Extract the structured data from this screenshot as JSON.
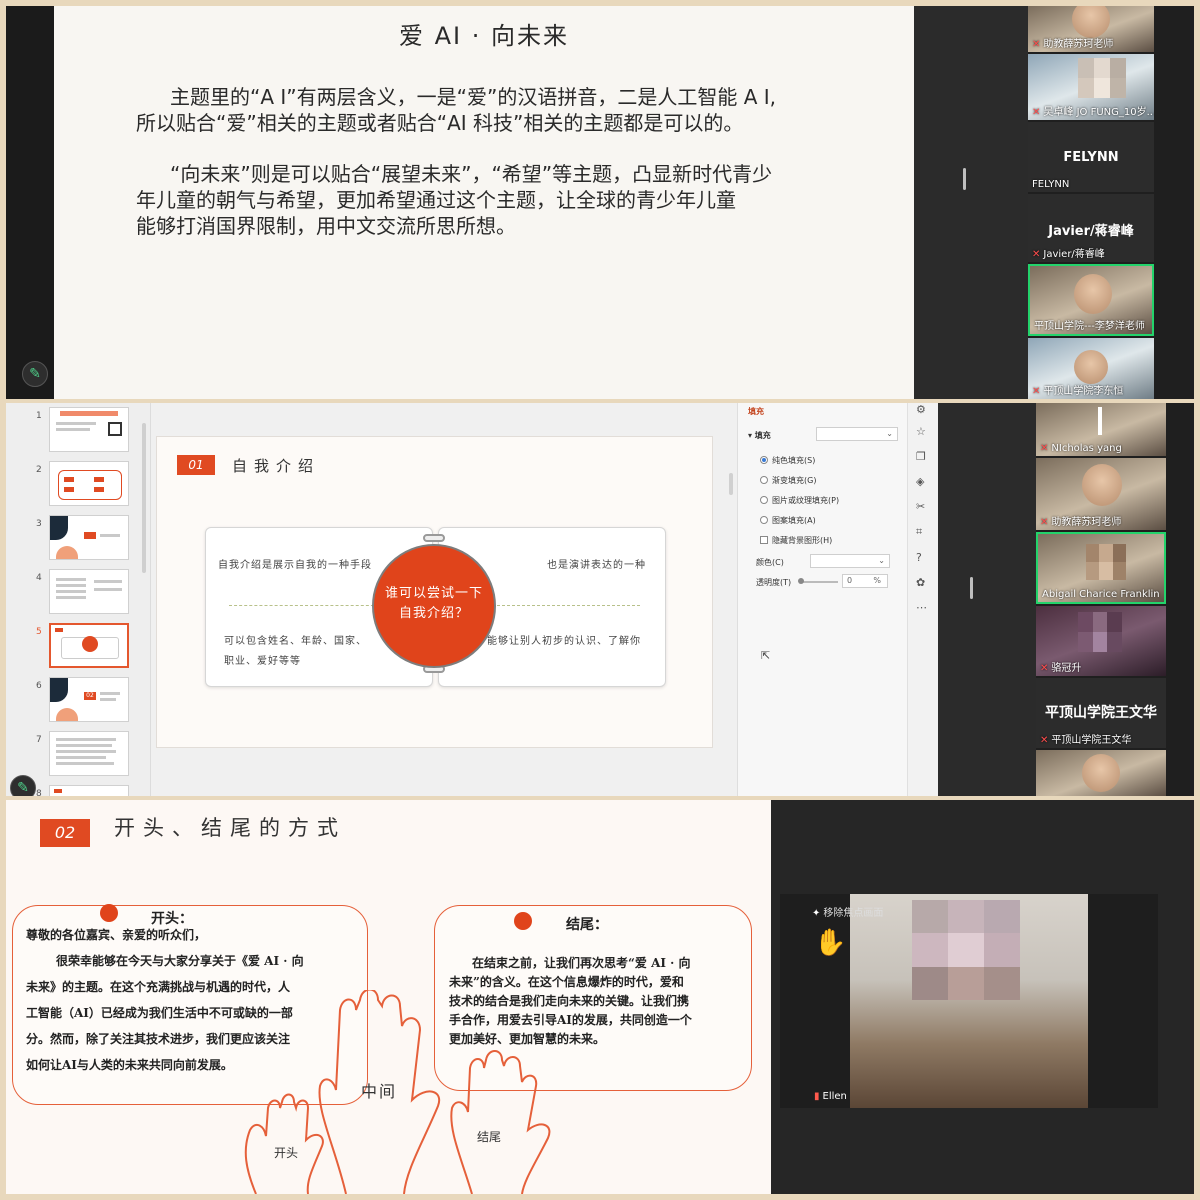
{
  "panel1": {
    "slide": {
      "title": "爱 AI · 向未来",
      "para1_l1": "主题里的“A I”有两层含义，一是“爱”的汉语拼音，二是人工智能 A I,",
      "para1_l2": "所以贴合“爱”相关的主题或者贴合“AI 科技”相关的主题都是可以的。",
      "para2_l1": "“向未来”则是可以贴合“展望未来”，“希望”等主题，凸显新时代青少",
      "para2_l2": "年儿童的朝气与希望，更加希望通过这个主题，让全球的青少年儿童",
      "para2_l3": "能够打消国界限制，用中文交流所思所想。"
    },
    "participants": [
      {
        "name": "助教薛苏珂老师"
      },
      {
        "name": "吴卓峰 JO FUNG_10岁..."
      },
      {
        "big": "FELYNN",
        "name": "FELYNN"
      },
      {
        "big": "Javier/蒋睿峰",
        "name": "Javier/蒋睿峰"
      },
      {
        "name": "平顶山学院---李梦洋老师"
      },
      {
        "name": "平顶山学院李东恒"
      }
    ]
  },
  "panel2": {
    "thumb_numbers": [
      "1",
      "2",
      "3",
      "4",
      "5",
      "6",
      "7",
      "8"
    ],
    "slide": {
      "badge": "01",
      "title": "自我介绍",
      "circle_l1": "谁可以尝试一下",
      "circle_l2": "自我介绍？",
      "left_top": "自我介绍是展示自我的一种手段",
      "left_bottom_l1": "可以包含姓名、年龄、国家、",
      "left_bottom_l2": "职业、爱好等等",
      "right_top": "也是演讲表达的一种",
      "right_bottom": "能够让别人初步的认识、了解你"
    },
    "thumb6_badge": "02",
    "properties": {
      "tab": "填充",
      "fill_label": "▾ 填充",
      "options": [
        "纯色填充(S)",
        "渐变填充(G)",
        "图片或纹理填充(P)",
        "图案填充(A)"
      ],
      "hide_bg": "隐藏背景图形(H)",
      "color_label": "颜色(C)",
      "transparency_label": "透明度(T)",
      "transparency_value": "0",
      "transparency_unit": "%"
    },
    "participants": [
      {
        "name": "NIcholas yang"
      },
      {
        "name": "助教薛苏珂老师"
      },
      {
        "name": "Abigail Charice Franklin"
      },
      {
        "name": "骆冠升"
      },
      {
        "big": "平顶山学院王文华",
        "name": "平顶山学院王文华"
      }
    ]
  },
  "panel3": {
    "slide": {
      "badge": "02",
      "title": "开头、结尾的方式",
      "open_head": "开头：",
      "open_l1": "尊敬的各位嘉宾、亲爱的听众们，",
      "open_l2": "很荣幸能够在今天与大家分享关于《爱 AI · 向",
      "open_l3": "未来》的主题。在这个充满挑战与机遇的时代，人",
      "open_l4": "工智能（AI）已经成为我们生活中不可或缺的一部",
      "open_l5": "分。然而，除了关注其技术进步，我们更应该关注",
      "open_l6": "如何让AI与人类的未来共同向前发展。",
      "end_head": "结尾：",
      "end_l1": "在结束之前，让我们再次思考“爱 AI · 向",
      "end_l2": "未来”的含义。在这个信息爆炸的时代，爱和",
      "end_l3": "技术的结合是我们走向未来的关键。让我们携",
      "end_l4": "手合作，用爱去引导AI的发展，共同创造一个",
      "end_l5": "更加美好、更加智慧的未来。",
      "hand_open": "开头",
      "hand_middle": "中间",
      "hand_end": "结尾"
    },
    "video": {
      "label": "移除焦点画面",
      "name": "Ellen",
      "hand_icon": "raised-hand-icon"
    }
  }
}
